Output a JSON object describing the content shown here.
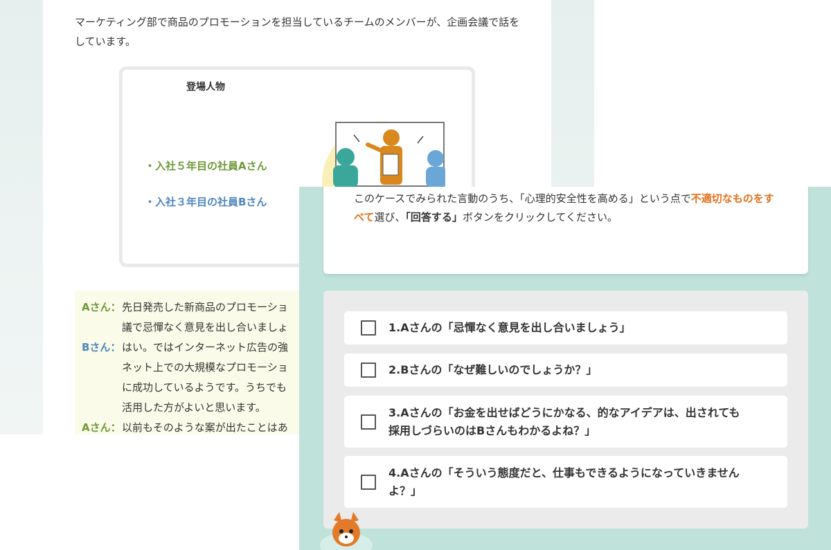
{
  "scenario": {
    "intro": "マーケティング部で商品のプロモーションを担当しているチームのメンバーが、企画会議で話をしています。",
    "characters_title": "登場人物",
    "character_a": "・入社５年目の社員Aさん",
    "character_b": "・入社３年目の社員Bさん",
    "dialog": [
      {
        "speaker": "Aさん：",
        "side": "a",
        "text": "先日発売した新商品のプロモーショ\n議で忌憚なく意見を出し合いましょ"
      },
      {
        "speaker": "Bさん：",
        "side": "b",
        "text": "はい。ではインターネット広告の強\nネット上での大規模なプロモーショ\nに成功しているようです。うちでも\n活用した方がよいと思います。"
      },
      {
        "speaker": "Aさん：",
        "side": "a",
        "text": "以前もそのような案が出たことはあ"
      }
    ]
  },
  "question": {
    "text_1": "このケースでみられた言動のうち、「心理的安全性を高める」という点で",
    "highlight": "不適切なものをすべて",
    "text_2": "選び、",
    "button_ref": "「回答する」",
    "text_3": "ボタンをクリックしてください。"
  },
  "options": [
    {
      "label": "1.Aさんの「忌憚なく意見を出し合いましょう」",
      "checked": false
    },
    {
      "label": "2.Bさんの「なぜ難しいのでしょうか？」",
      "checked": false
    },
    {
      "label": "3.Aさんの「お金を出せばどうにかなる、的なアイデアは、出されても\n採用しづらいのはBさんもわかるよね？」",
      "checked": false
    },
    {
      "label": "4.Aさんの「そういう態度だと、仕事もできるようになっていきません\nよ？」",
      "checked": false
    }
  ],
  "colors": {
    "speaker_a": "#6f9a3a",
    "speaker_b": "#4f86be",
    "highlight": "#e0711c",
    "front_bg": "#bfe2da",
    "dialog_bg": "#fbfbe9"
  }
}
